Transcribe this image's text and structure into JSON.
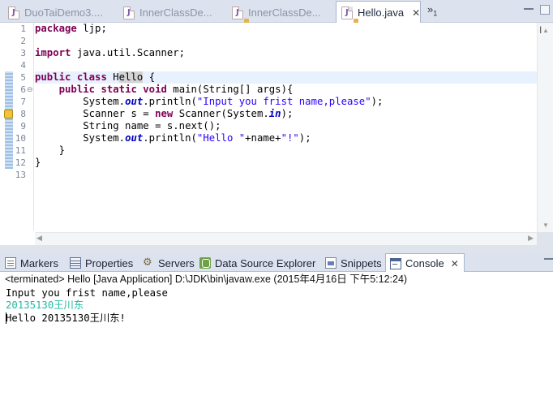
{
  "editor_tabs": [
    {
      "label": "DuoTaiDemo3....",
      "active": false
    },
    {
      "label": "InnerClassDe...",
      "active": false
    },
    {
      "label": "InnerClassDe...",
      "active": false
    },
    {
      "label": "Hello.java",
      "active": true
    }
  ],
  "editor_overflow": {
    "chevron": "»",
    "count": "1"
  },
  "side_peek": "I",
  "line_numbers": [
    "1",
    "2",
    "3",
    "4",
    "5",
    "6",
    "7",
    "8",
    "9",
    "10",
    "11",
    "12",
    "13"
  ],
  "fold_markers": {
    "6": "⊖"
  },
  "code": {
    "l1_kw": "package",
    "l1_rest": " ljp;",
    "l3_kw": "import",
    "l3_rest": " java.util.Scanner;",
    "l5_kw1": "public",
    "l5_kw2": "class",
    "l5_pre": " H",
    "l5_hl": "ello",
    "l5_post": " {",
    "l6_indent": "    ",
    "l6_kw1": "public",
    "l6_kw2": "static",
    "l6_kw3": "void",
    "l6_rest": " main(String[] args){",
    "l7_pre": "        System.",
    "l7_field": "out",
    "l7_mid": ".println(",
    "l7_str": "\"Input you frist name,please\"",
    "l7_end": ");",
    "l8_pre": "        Scanner s = ",
    "l8_kw": "new",
    "l8_mid": " Scanner(System.",
    "l8_field": "in",
    "l8_end": ");",
    "l9": "        String name = s.next();",
    "l10_pre": "        System.",
    "l10_field": "out",
    "l10_mid": ".println(",
    "l10_str1": "\"Hello \"",
    "l10_plus": "+name+",
    "l10_str2": "\"!\"",
    "l10_end": ");",
    "l11": "    }",
    "l12": "}"
  },
  "view_tabs": [
    {
      "label": "Markers",
      "icon": "markers-icon"
    },
    {
      "label": "Properties",
      "icon": "properties-icon"
    },
    {
      "label": "Servers",
      "icon": "servers-icon"
    },
    {
      "label": "Data Source Explorer",
      "icon": "data-source-icon"
    },
    {
      "label": "Snippets",
      "icon": "snippets-icon"
    },
    {
      "label": "Console",
      "icon": "console-icon",
      "active": true
    }
  ],
  "console": {
    "header": "<terminated> Hello [Java Application] D:\\JDK\\bin\\javaw.exe (2015年4月16日 下午5:12:24)",
    "line1": "Input you frist name,please",
    "line2": "20135130王川东",
    "line3": "Hello 20135130王川东!"
  },
  "colors": {
    "keyword": "#7f0055",
    "string": "#2a00ff",
    "field": "#0000c0",
    "console_input": "#22b8a0"
  }
}
